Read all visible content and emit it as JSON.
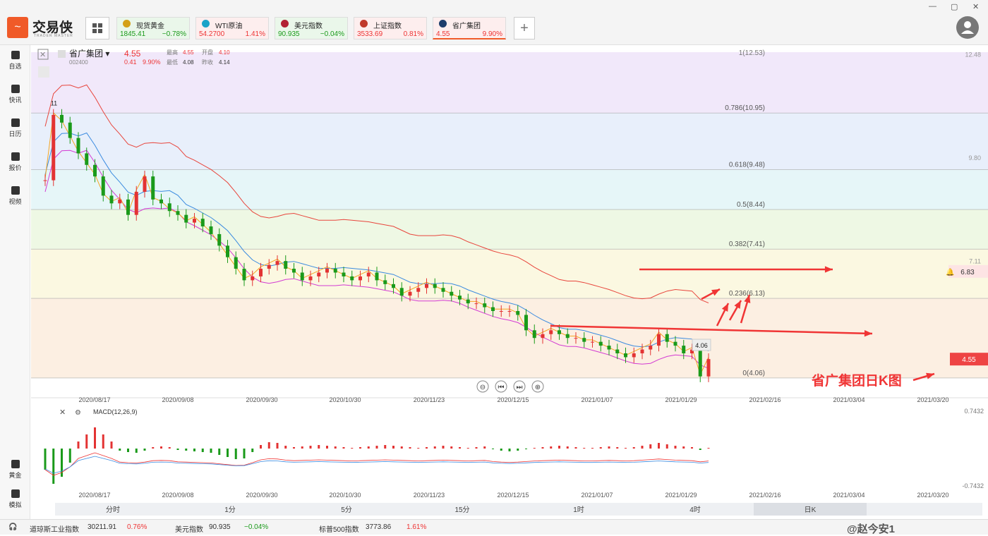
{
  "app": {
    "brand": "交易侠",
    "brand_sub": "TRADER MASTER"
  },
  "window_controls": [
    "—",
    "▢",
    "✕"
  ],
  "tickers": [
    {
      "name": "现货黄金",
      "price": "1845.41",
      "change": "−0.78%",
      "dir": "dn",
      "icon_color": "#d4a017"
    },
    {
      "name": "WTI原油",
      "price": "54.2700",
      "change": "1.41%",
      "dir": "up",
      "icon_color": "#1aa3c8"
    },
    {
      "name": "美元指数",
      "price": "90.935",
      "change": "−0.04%",
      "dir": "dn",
      "icon_color": "#b22234"
    },
    {
      "name": "上证指数",
      "price": "3533.69",
      "change": "0.81%",
      "dir": "up",
      "icon_color": "#c0392b"
    },
    {
      "name": "省广集团",
      "price": "4.55",
      "change": "9.90%",
      "dir": "up",
      "icon_color": "#1d3d6b"
    }
  ],
  "sidebar": [
    {
      "label": "自选",
      "icon": "bookmark-icon"
    },
    {
      "label": "快讯",
      "icon": "news-icon"
    },
    {
      "label": "日历",
      "icon": "calendar-icon"
    },
    {
      "label": "报价",
      "icon": "quote-chart-icon"
    },
    {
      "label": "视频",
      "icon": "video-icon"
    },
    {
      "label": "黄金",
      "icon": "gold-icon"
    },
    {
      "label": "模拟",
      "icon": "wallet-icon"
    }
  ],
  "stock": {
    "name": "省广集团",
    "code": "002400",
    "price": "4.55",
    "change": "0.41",
    "change_pct": "9.90%",
    "high_label": "最高",
    "high": "4.55",
    "open_label": "开盘",
    "open": "4.10",
    "low_label": "最低",
    "low": "4.08",
    "prev_label": "昨收",
    "prev": "4.14"
  },
  "chart_data": {
    "type": "candlestick",
    "y_labels": [
      "12.48",
      "9.80",
      "7.11"
    ],
    "x_labels": [
      "2020/08/17",
      "2020/09/08",
      "2020/09/30",
      "2020/10/30",
      "2020/11/23",
      "2020/12/15",
      "2021/01/07",
      "2021/01/29",
      "2021/02/16",
      "2021/03/04",
      "2021/03/20"
    ],
    "fib_top": "1(12.53)",
    "fib_levels": [
      {
        "label": "0.786(10.95)",
        "value": 10.95
      },
      {
        "label": "0.618(9.48)",
        "value": 9.48
      },
      {
        "label": "0.5(8.44)",
        "value": 8.44
      },
      {
        "label": "0.382(7.41)",
        "value": 7.41
      },
      {
        "label": "0.236(6.13)",
        "value": 6.13
      },
      {
        "label": "0(4.06)",
        "value": 4.06
      }
    ],
    "high_marker": "11",
    "low_marker": "4.06",
    "alert_price": "6.83",
    "current_price": "4.55",
    "annotation": "省广集团日K图",
    "candles": [
      9.2,
      10.9,
      10.7,
      10.3,
      9.9,
      9.6,
      9.3,
      8.8,
      8.6,
      8.7,
      8.3,
      8.9,
      9.3,
      8.7,
      8.6,
      8.4,
      8.3,
      8.1,
      8.2,
      8.0,
      7.8,
      7.5,
      7.2,
      6.9,
      6.6,
      6.7,
      6.9,
      7.0,
      7.1,
      6.9,
      6.8,
      6.6,
      6.7,
      6.8,
      6.9,
      6.8,
      6.7,
      6.6,
      6.7,
      6.8,
      6.6,
      6.5,
      6.4,
      6.2,
      6.3,
      6.4,
      6.5,
      6.4,
      6.3,
      6.2,
      6.1,
      6.0,
      6.0,
      5.9,
      5.8,
      5.8,
      5.8,
      5.7,
      5.3,
      5.1,
      5.2,
      5.3,
      5.2,
      5.1,
      5.1,
      5.0,
      5.0,
      4.9,
      4.8,
      4.7,
      4.6,
      4.7,
      4.8,
      4.9,
      5.2,
      5.0,
      4.9,
      4.7,
      4.8,
      4.1,
      4.55
    ]
  },
  "zoom_controls": [
    "⊖",
    "⏮",
    "⏭",
    "⊕"
  ],
  "macd": {
    "title": "MACD(12,26,9)",
    "y_top": "0.7432",
    "y_bottom": "-0.7432",
    "hist": [
      -3,
      -5,
      -4,
      -2,
      1,
      2,
      3,
      2,
      1,
      -0.3,
      -0.5,
      -0.6,
      -0.3,
      0.2,
      0.3,
      0.2,
      -0.2,
      -0.3,
      -0.4,
      -0.5,
      -0.6,
      -0.9,
      -1.2,
      -1.5,
      -1.4,
      -0.5,
      0.5,
      0.9,
      0.8,
      0.4,
      0.2,
      0.3,
      0.4,
      0.5,
      0.4,
      0.3,
      0.2,
      0.1,
      0.2,
      0.3,
      0.4,
      0.5,
      0.4,
      0.3,
      0.2,
      0.1,
      0.2,
      0.3,
      0.4,
      0.3,
      0.2,
      0.1,
      0.2,
      0.3,
      -0.1,
      -0.3,
      -0.4,
      -0.3,
      -0.1,
      0.1,
      0.2,
      0.3,
      0.4,
      0.3,
      0.2,
      0.1,
      0.1,
      0.2,
      0.3,
      0.2,
      0.1,
      0.2,
      0.4,
      0.6,
      0.8,
      0.6,
      0.4,
      0.3,
      0.2,
      -0.2,
      0.1
    ]
  },
  "periods": [
    "分时",
    "1分",
    "5分",
    "15分",
    "1时",
    "4时",
    "日K"
  ],
  "active_period": "日K",
  "bottom_indices": [
    {
      "name": "道琼斯工业指数",
      "value": "30211.91",
      "change": "0.76%",
      "dir": "up"
    },
    {
      "name": "美元指数",
      "value": "90.935",
      "change": "−0.04%",
      "dir": "dn"
    },
    {
      "name": "标普500指数",
      "value": "3773.86",
      "change": "1.61%",
      "dir": "up"
    }
  ],
  "watermark": "@赵今安1",
  "colors": {
    "up": "#e33333",
    "down": "#1a9a1a",
    "accent": "#f05a28"
  }
}
